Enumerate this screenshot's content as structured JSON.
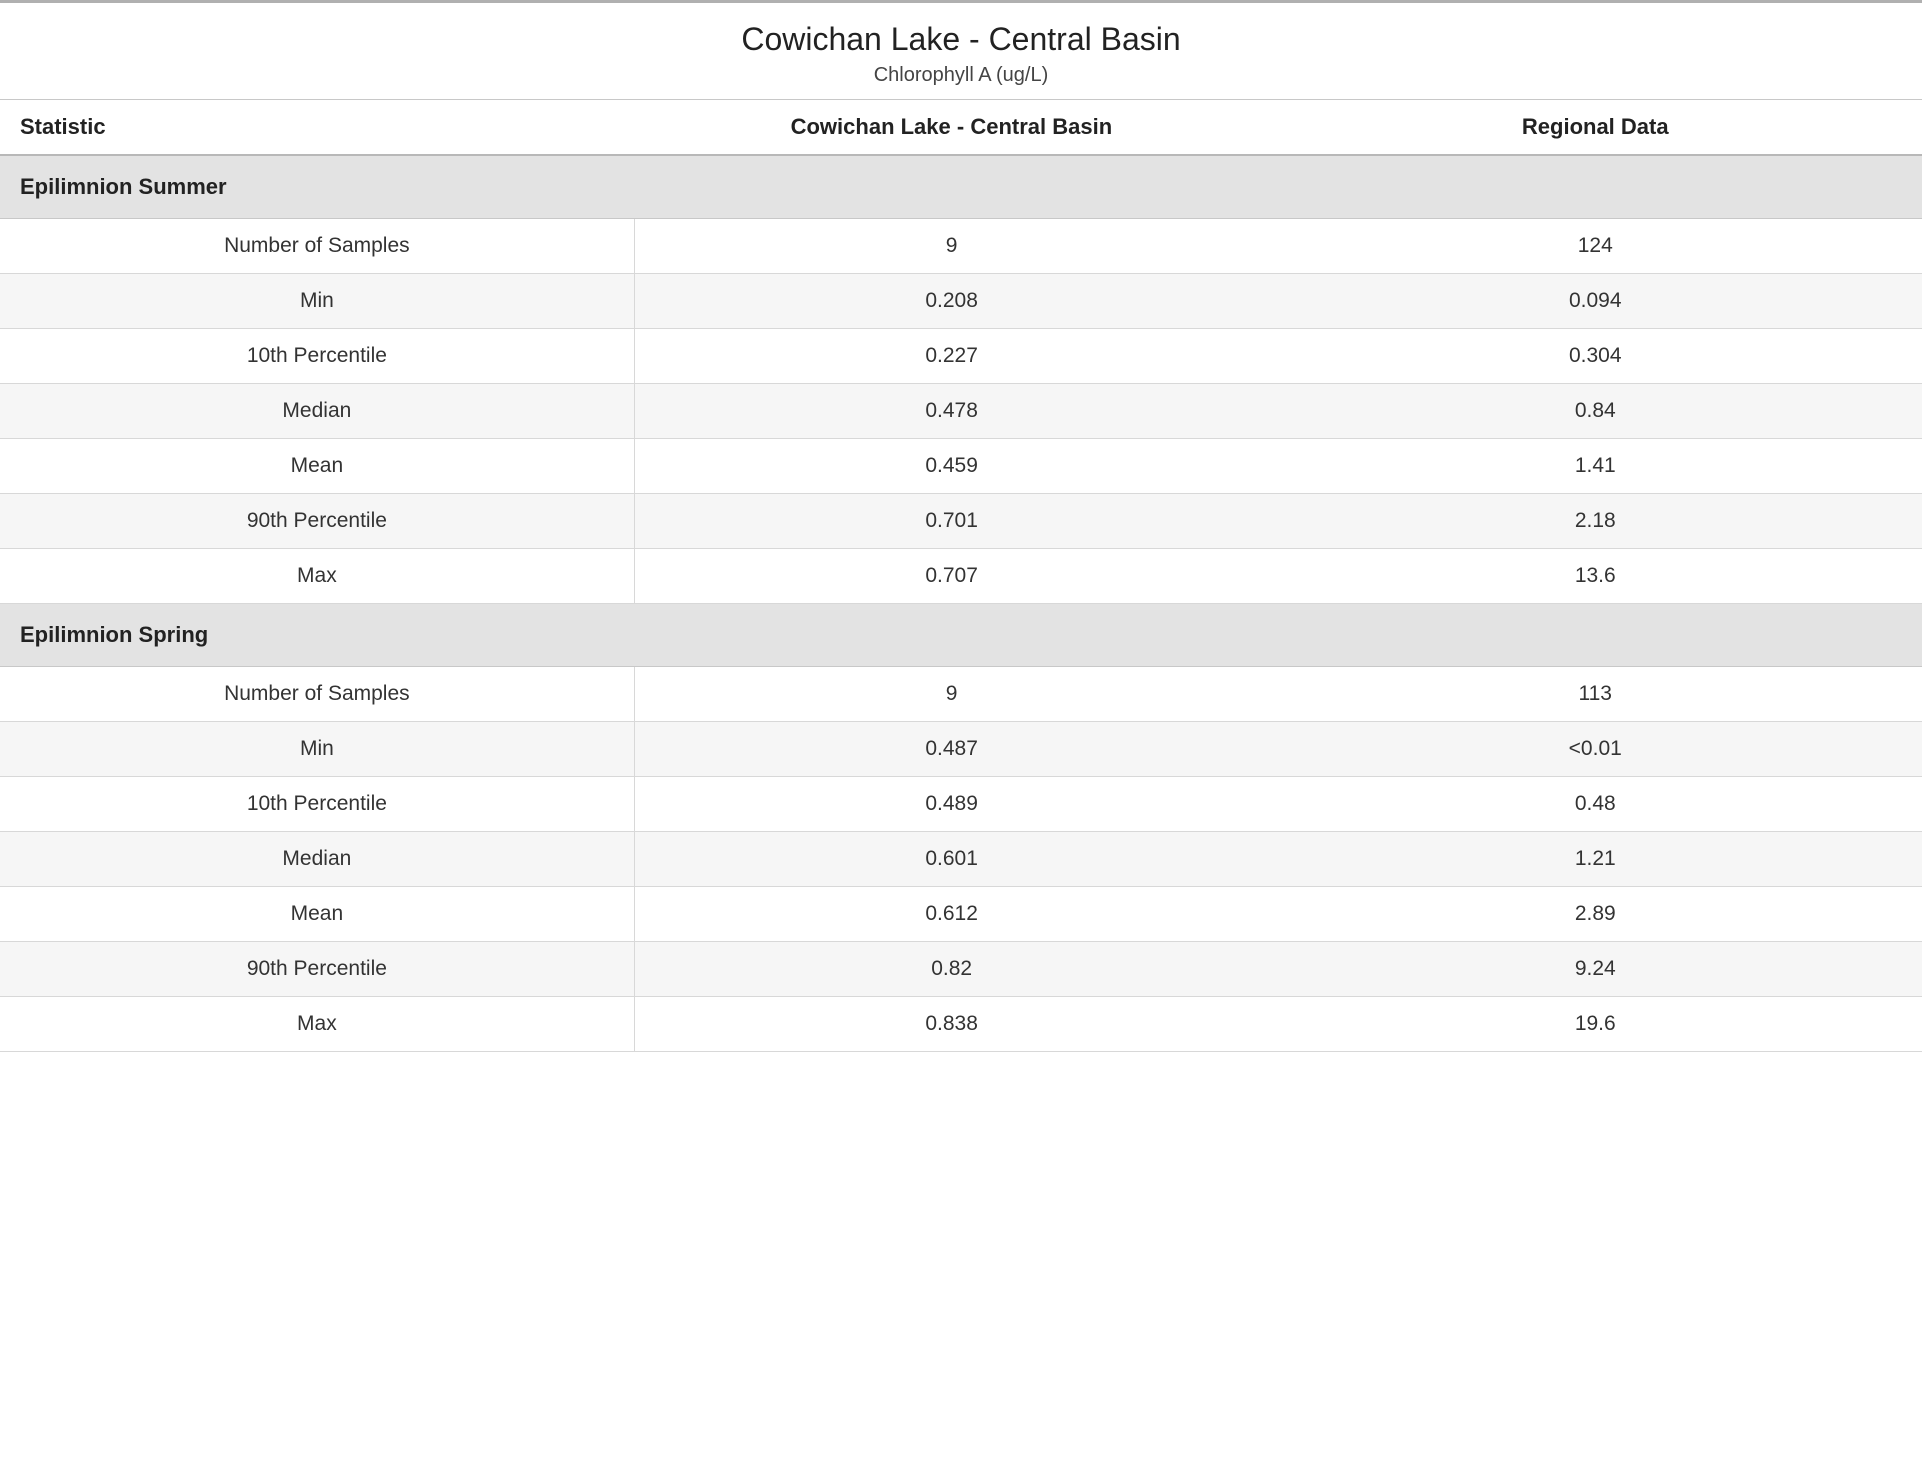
{
  "title": "Cowichan Lake - Central Basin",
  "subtitle": "Chlorophyll A (ug/L)",
  "columns": {
    "stat": "Statistic",
    "site": "Cowichan Lake - Central Basin",
    "region": "Regional Data"
  },
  "sections": [
    {
      "name": "Epilimnion Summer",
      "rows": [
        {
          "stat": "Number of Samples",
          "site": "9",
          "region": "124"
        },
        {
          "stat": "Min",
          "site": "0.208",
          "region": "0.094"
        },
        {
          "stat": "10th Percentile",
          "site": "0.227",
          "region": "0.304"
        },
        {
          "stat": "Median",
          "site": "0.478",
          "region": "0.84"
        },
        {
          "stat": "Mean",
          "site": "0.459",
          "region": "1.41"
        },
        {
          "stat": "90th Percentile",
          "site": "0.701",
          "region": "2.18"
        },
        {
          "stat": "Max",
          "site": "0.707",
          "region": "13.6"
        }
      ]
    },
    {
      "name": "Epilimnion Spring",
      "rows": [
        {
          "stat": "Number of Samples",
          "site": "9",
          "region": "113"
        },
        {
          "stat": "Min",
          "site": "0.487",
          "region": "<0.01"
        },
        {
          "stat": "10th Percentile",
          "site": "0.489",
          "region": "0.48"
        },
        {
          "stat": "Median",
          "site": "0.601",
          "region": "1.21"
        },
        {
          "stat": "Mean",
          "site": "0.612",
          "region": "2.89"
        },
        {
          "stat": "90th Percentile",
          "site": "0.82",
          "region": "9.24"
        },
        {
          "stat": "Max",
          "site": "0.838",
          "region": "19.6"
        }
      ]
    }
  ]
}
